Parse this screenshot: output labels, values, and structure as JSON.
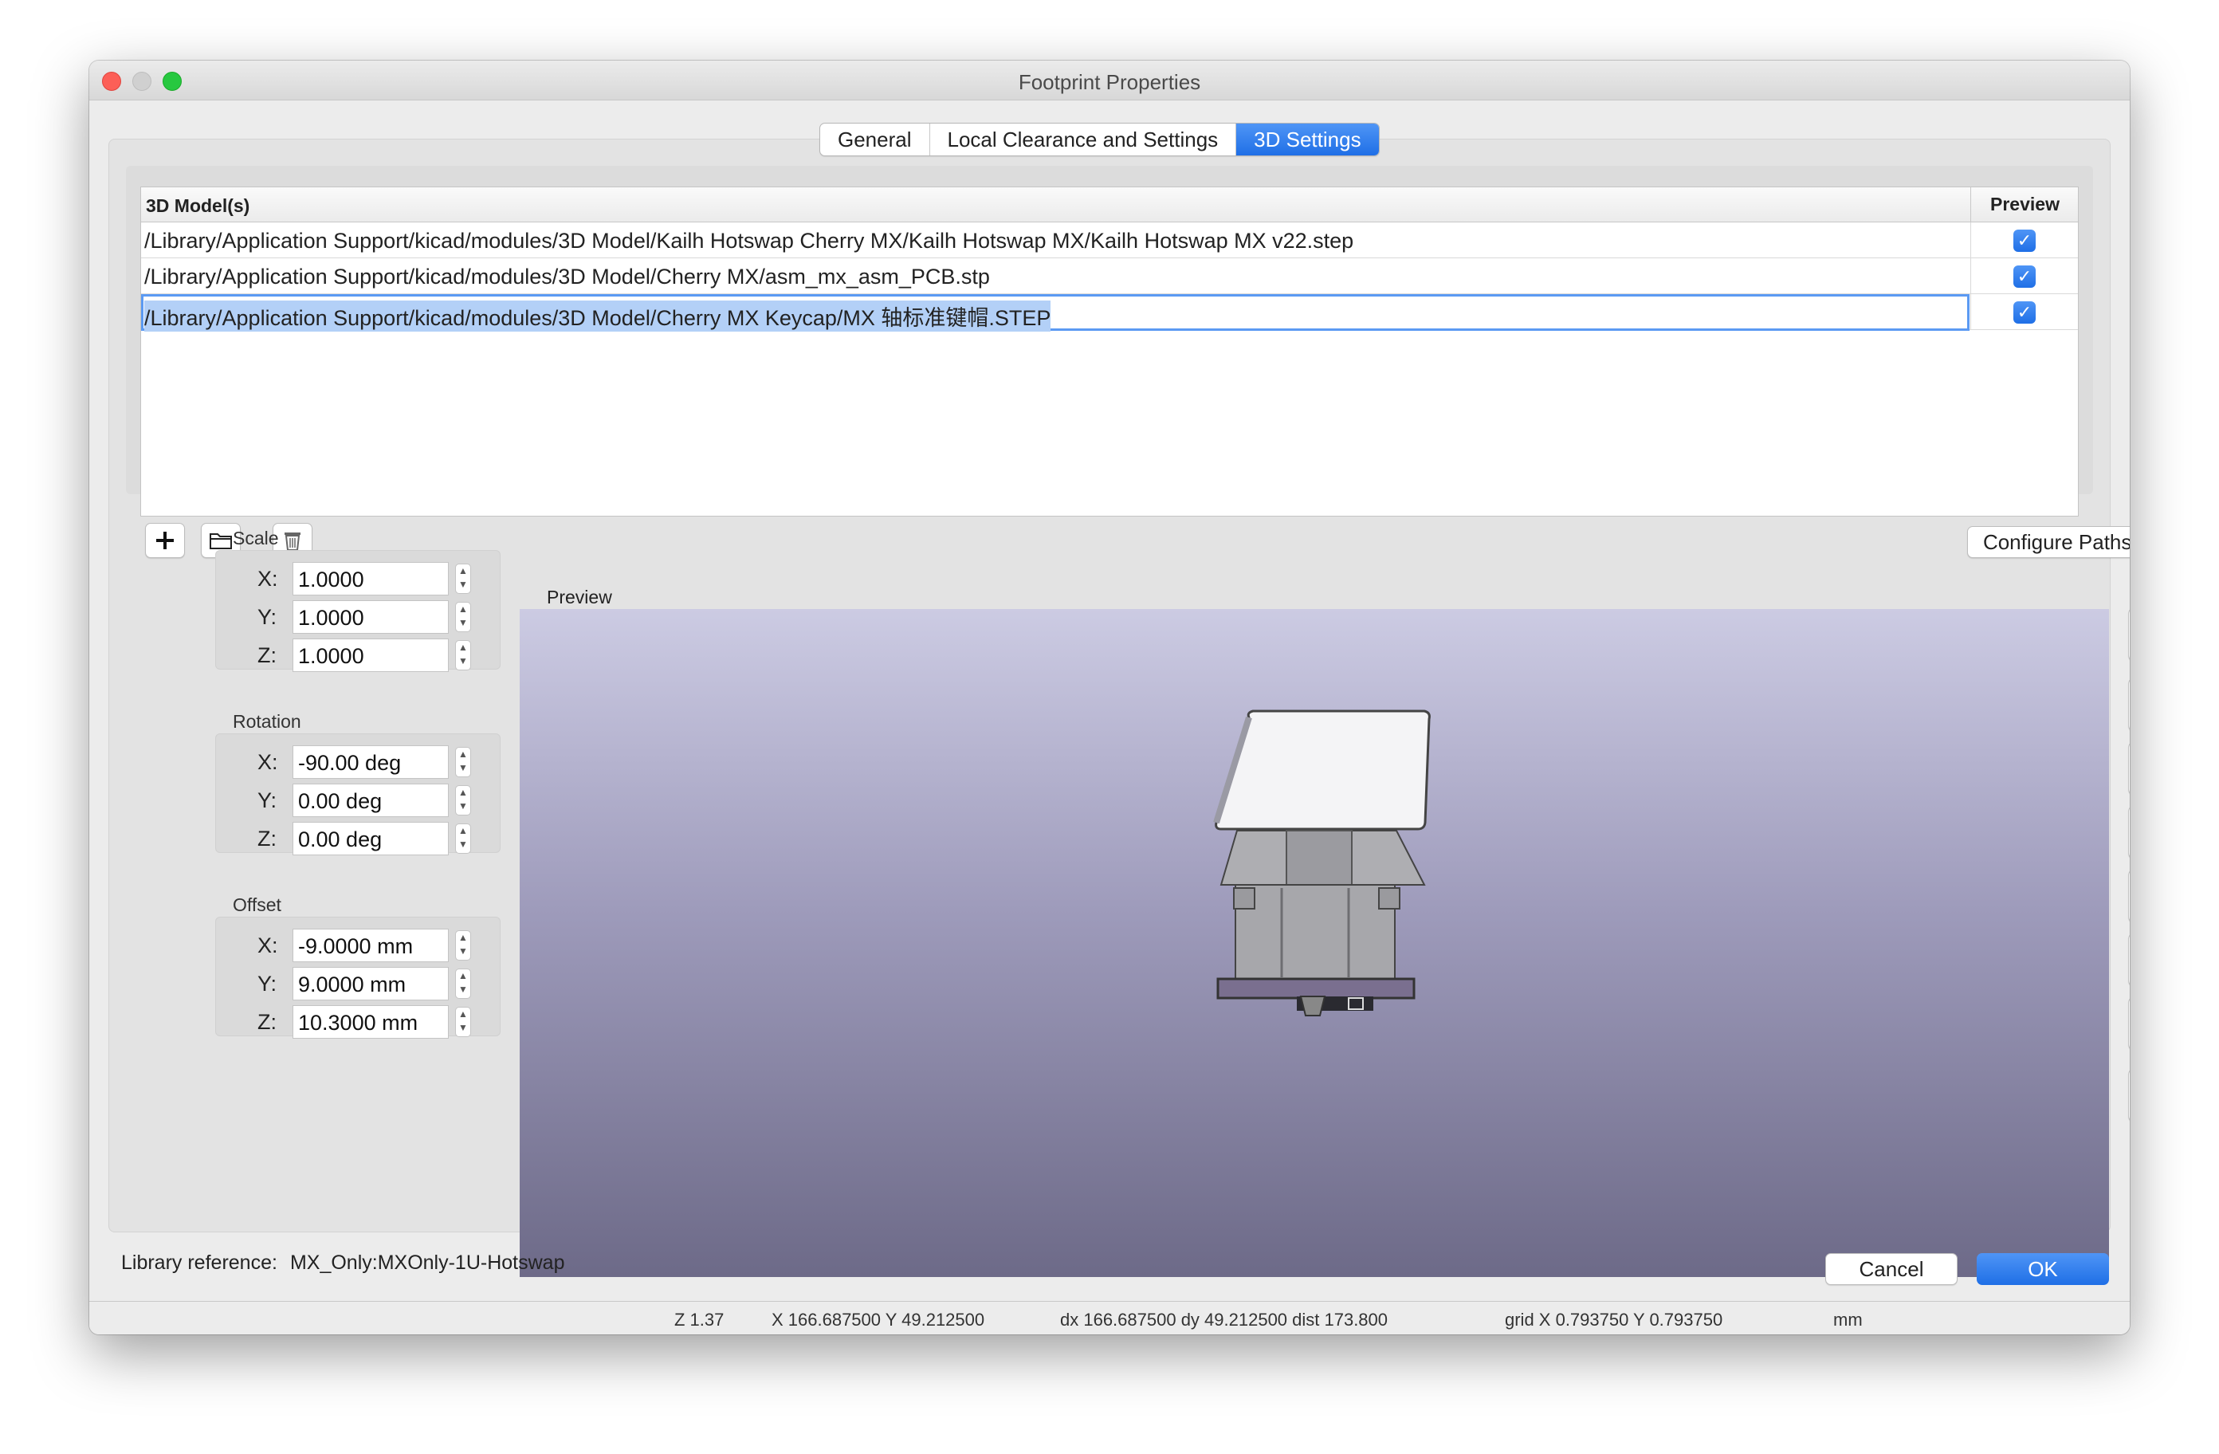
{
  "window": {
    "title": "Footprint Properties"
  },
  "tabs": [
    {
      "label": "General",
      "active": false
    },
    {
      "label": "Local Clearance and Settings",
      "active": false
    },
    {
      "label": "3D Settings",
      "active": true
    }
  ],
  "models_table": {
    "header_model": "3D Model(s)",
    "header_preview": "Preview",
    "rows": [
      {
        "path": "/Library/Application Support/kicad/modules/3D Model/Kailh Hotswap Cherry MX/Kailh Hotswap MX/Kailh Hotswap MX v22.step",
        "preview": true,
        "selected": false
      },
      {
        "path": "/Library/Application Support/kicad/modules/3D Model/Cherry MX/asm_mx_asm_PCB.stp",
        "preview": true,
        "selected": false
      },
      {
        "path": "/Library/Application Support/kicad/modules/3D Model/Cherry MX Keycap/MX 轴标准键帽.STEP",
        "preview": true,
        "selected": true
      }
    ],
    "toolbar_icons": [
      "plus-icon",
      "folder-icon",
      "trash-icon"
    ],
    "configure_label": "Configure Paths..."
  },
  "scale": {
    "label": "Scale",
    "x_label": "X:",
    "y_label": "Y:",
    "z_label": "Z:",
    "x": "1.0000",
    "y": "1.0000",
    "z": "1.0000"
  },
  "rotation": {
    "label": "Rotation",
    "x_label": "X:",
    "y_label": "Y:",
    "z_label": "Z:",
    "x": "-90.00 deg",
    "y": "0.00 deg",
    "z": "0.00 deg"
  },
  "offset": {
    "label": "Offset",
    "x_label": "X:",
    "y_label": "Y:",
    "z_label": "Z:",
    "x": "-9.0000 mm",
    "y": "9.0000 mm",
    "z": "10.3000 mm"
  },
  "preview": {
    "label": "Preview"
  },
  "view_buttons": [
    "iso-view-icon",
    "front-view-icon",
    "back-view-icon",
    "left-view-icon",
    "right-view-icon",
    "top-view-icon",
    "bottom-view-icon",
    "reload-icon"
  ],
  "footer": {
    "lib_ref_label": "Library reference:",
    "lib_ref_value": "MX_Only:MXOnly-1U-Hotswap",
    "cancel_label": "Cancel",
    "ok_label": "OK"
  },
  "status_bar": {
    "z": "Z 1.37",
    "xy": "X 166.687500  Y 49.212500",
    "dxy": "dx 166.687500  dy 49.212500  dist 173.800",
    "grid": "grid X 0.793750  Y 0.793750",
    "units": "mm"
  },
  "colors": {
    "accent": "#1f6fe6",
    "viewport_top": "#cccbe3",
    "viewport_bottom": "#6d6a88",
    "view_icon": "#1b9bb5"
  }
}
